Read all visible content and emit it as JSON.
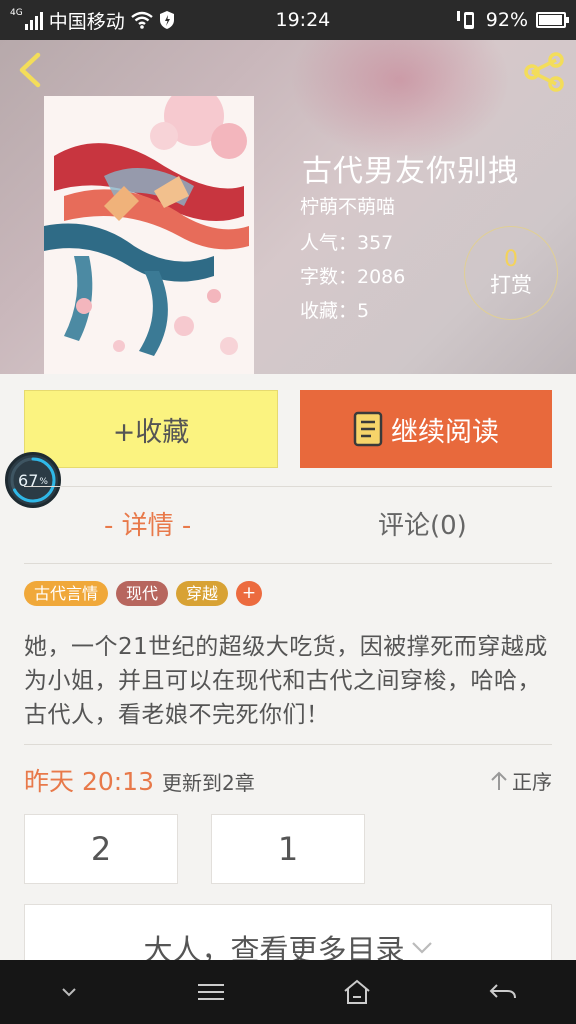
{
  "status_bar": {
    "network": "4G",
    "carrier": "中国移动",
    "time": "19:24",
    "battery": "92%"
  },
  "book": {
    "title": "古代男友你别拽",
    "author": "柠萌不萌喵",
    "popularity": "人气：357",
    "word_count": "字数：2086",
    "favorites": "收藏：5"
  },
  "reward": {
    "count": "0",
    "label": "打赏"
  },
  "actions": {
    "favorite_label": "+收藏",
    "read_label": "继续阅读"
  },
  "reading_progress": {
    "value": "67",
    "unit": "%",
    "fraction": 0.67
  },
  "tabs": {
    "detail": "- 详情 -",
    "comments": "评论(0)"
  },
  "tags": [
    {
      "label": "古代言情",
      "color": "#f0a83a"
    },
    {
      "label": "现代",
      "color": "#b7665e"
    },
    {
      "label": "穿越",
      "color": "#d8a234"
    },
    {
      "label": "+",
      "color": "#ec6b3f"
    }
  ],
  "description": "她，一个21世纪的超级大吃货，因被撑死而穿越成为小姐，并且可以在现代和古代之间穿梭，哈哈，古代人，看老娘不完死你们！",
  "update": {
    "time": "昨天 20:13",
    "text": "更新到2章",
    "sort_label": "正序"
  },
  "chapters": [
    "2",
    "1"
  ],
  "more_catalog": "大人，查看更多目录",
  "colors": {
    "accent": "#e8693c",
    "favorite_button": "#fbf380",
    "tab_active": "#e8794a"
  }
}
